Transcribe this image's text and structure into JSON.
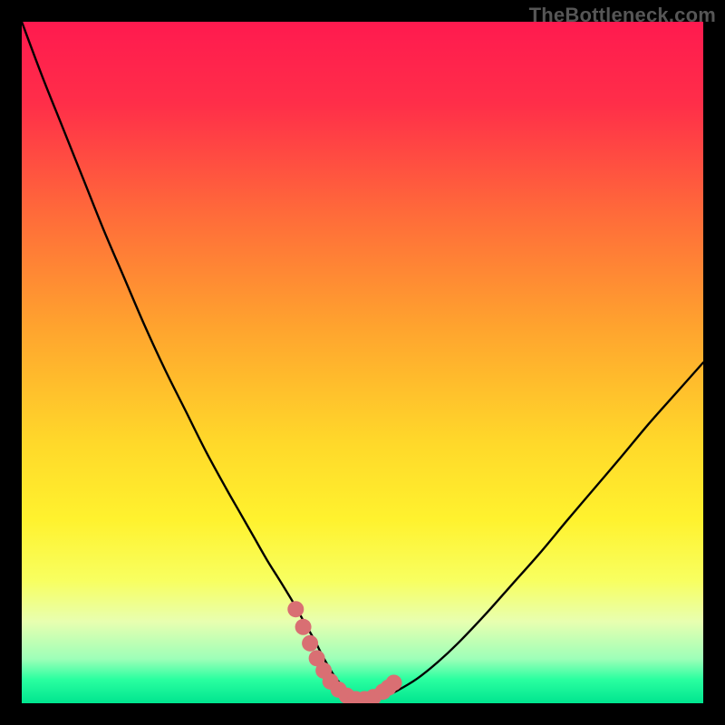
{
  "meta": {
    "watermark": "TheBottleneck.com"
  },
  "colors": {
    "background": "#000000",
    "gradient_stops": [
      {
        "offset": 0.0,
        "color": "#ff1a4f"
      },
      {
        "offset": 0.12,
        "color": "#ff2e49"
      },
      {
        "offset": 0.28,
        "color": "#ff6a3a"
      },
      {
        "offset": 0.45,
        "color": "#ffa42e"
      },
      {
        "offset": 0.62,
        "color": "#ffd92a"
      },
      {
        "offset": 0.73,
        "color": "#fff22e"
      },
      {
        "offset": 0.82,
        "color": "#f8ff60"
      },
      {
        "offset": 0.88,
        "color": "#e8ffb0"
      },
      {
        "offset": 0.935,
        "color": "#9dffb8"
      },
      {
        "offset": 0.965,
        "color": "#2affa0"
      },
      {
        "offset": 1.0,
        "color": "#00e58f"
      }
    ],
    "curve": "#000000",
    "marker_fill": "#d96f73",
    "marker_stroke": "#c75a5e"
  },
  "chart_data": {
    "type": "line",
    "title": "",
    "xlabel": "",
    "ylabel": "",
    "xlim": [
      0,
      100
    ],
    "ylim": [
      0,
      100
    ],
    "grid": false,
    "legend": false,
    "x": [
      0,
      3,
      6,
      9,
      12,
      15,
      18,
      21,
      24,
      27,
      30,
      32,
      34,
      36,
      38,
      40,
      41.5,
      43,
      44,
      45,
      46,
      47,
      48,
      49,
      50,
      51,
      53,
      55,
      58,
      61,
      64,
      68,
      72,
      76,
      80,
      84,
      88,
      92,
      96,
      100
    ],
    "y": [
      100,
      92,
      84.5,
      77,
      69.5,
      62.5,
      55.5,
      49,
      43,
      37,
      31.5,
      28,
      24.5,
      21,
      17.8,
      14.5,
      11.8,
      9.2,
      7.2,
      5.4,
      3.8,
      2.6,
      1.6,
      0.9,
      0.5,
      0.5,
      0.9,
      1.8,
      3.6,
      6.0,
      8.8,
      13.0,
      17.5,
      22.0,
      26.8,
      31.5,
      36.2,
      41.0,
      45.5,
      50.0
    ],
    "markers": {
      "x": [
        40.2,
        41.3,
        42.3,
        43.3,
        44.3,
        45.3,
        46.5,
        47.7,
        49.0,
        50.3,
        51.6,
        53.0,
        53.8,
        54.6
      ],
      "y": [
        13.8,
        11.2,
        8.8,
        6.6,
        4.8,
        3.2,
        2.0,
        1.1,
        0.6,
        0.6,
        0.9,
        1.7,
        2.3,
        3.0
      ]
    }
  }
}
